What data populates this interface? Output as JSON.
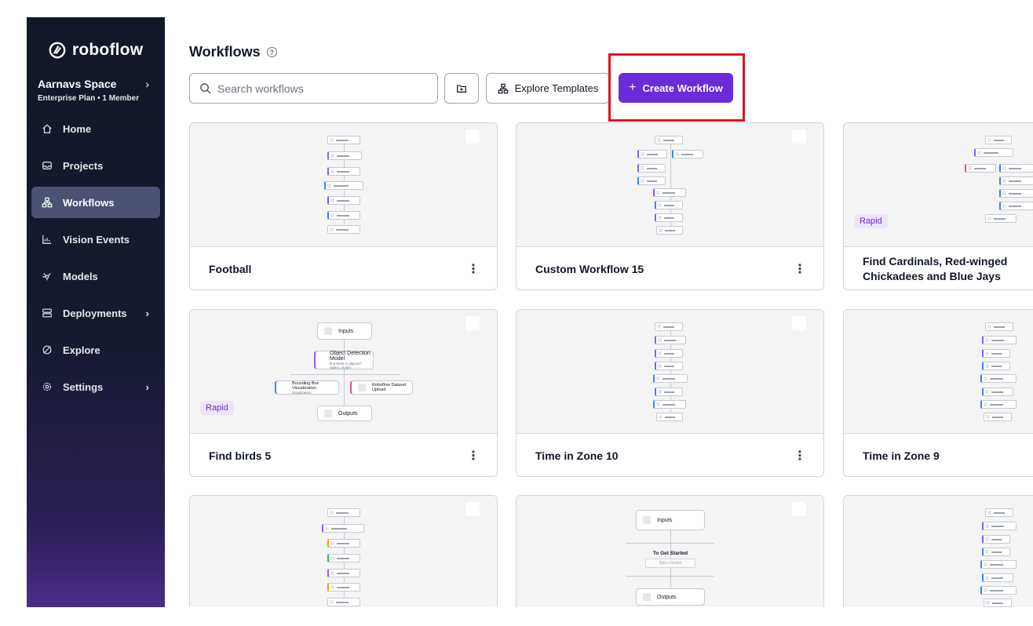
{
  "brand": {
    "name": "roboflow"
  },
  "workspace": {
    "name": "Aarnavs Space",
    "plan": "Enterprise Plan • 1 Member"
  },
  "nav": [
    {
      "label": "Home",
      "icon": "home-icon"
    },
    {
      "label": "Projects",
      "icon": "projects-icon"
    },
    {
      "label": "Workflows",
      "icon": "workflows-icon",
      "active": true
    },
    {
      "label": "Vision Events",
      "icon": "chart-icon"
    },
    {
      "label": "Models",
      "icon": "models-icon"
    },
    {
      "label": "Deployments",
      "icon": "deployments-icon",
      "has_submenu": true
    },
    {
      "label": "Explore",
      "icon": "compass-icon"
    },
    {
      "label": "Settings",
      "icon": "gear-icon",
      "has_submenu": true
    }
  ],
  "header": {
    "title": "Workflows",
    "search_placeholder": "Search workflows",
    "explore_templates": "Explore Templates",
    "create_workflow": "Create Workflow"
  },
  "cards": [
    {
      "title": "Football",
      "badge": ""
    },
    {
      "title": "Custom Workflow 15",
      "badge": ""
    },
    {
      "title": "Find Cardinals, Red-winged Chickadees and Blue Jays",
      "badge": "Rapid"
    },
    {
      "title": "Find birds 5",
      "badge": "Rapid"
    },
    {
      "title": "Time in Zone 10",
      "badge": ""
    },
    {
      "title": "Time in Zone 9",
      "badge": ""
    }
  ],
  "previews": {
    "birds": {
      "inputs": "Inputs",
      "model": "Object Detection Model",
      "model_sub1": "find birds in objects?",
      "model_sub2": "object_model",
      "bbox": "Bounding Box Visualization",
      "bbox_sub": "visualization",
      "upload": "Roboflow Dataset Upload",
      "outputs": "Outputs"
    },
    "started": {
      "inputs": "Inputs",
      "title": "To Get Started",
      "add": "Add a Model",
      "outputs": "Outputs"
    }
  },
  "colors": {
    "accent": "#6a2bd8",
    "highlight": "#e0141b",
    "sidebar": "#111827"
  }
}
